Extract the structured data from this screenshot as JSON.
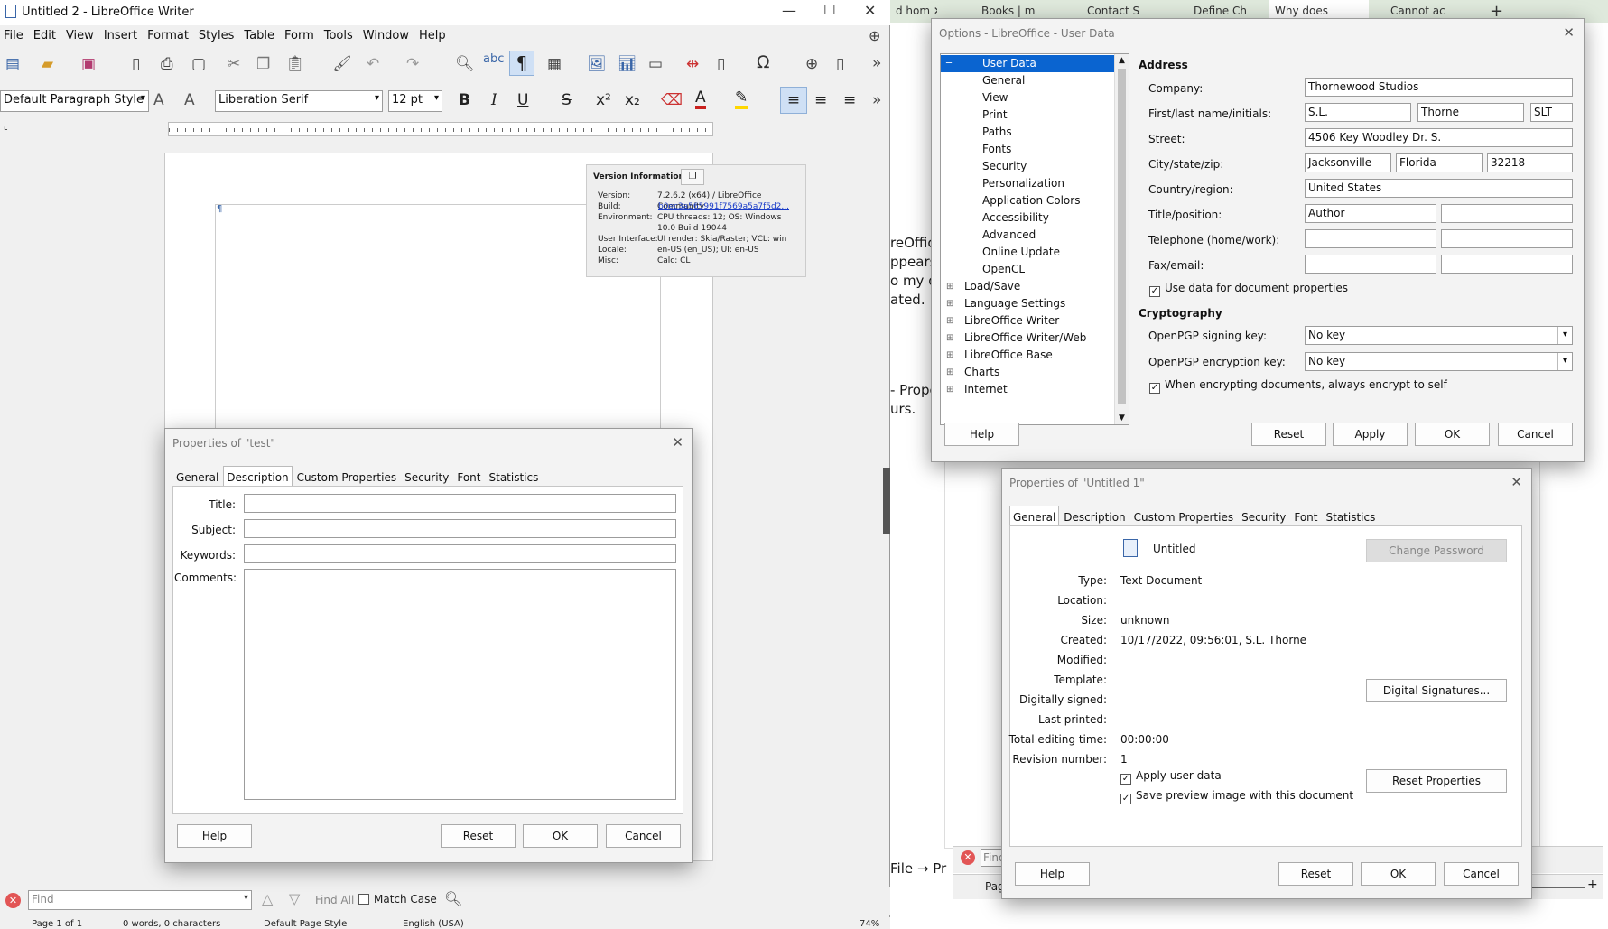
{
  "writer": {
    "title": "Untitled 2 - LibreOffice Writer",
    "menu": [
      "File",
      "Edit",
      "View",
      "Insert",
      "Format",
      "Styles",
      "Table",
      "Form",
      "Tools",
      "Window",
      "Help"
    ],
    "paragraph_style": "Default Paragraph Style",
    "font_name": "Liberation Serif",
    "font_size": "12 pt",
    "find_placeholder": "Find",
    "find_all": "Find All",
    "match_case": "Match Case",
    "status": {
      "page": "Page 1 of 1",
      "words": "0 words, 0 characters",
      "style": "Default Page Style",
      "lang": "English (USA)",
      "zoom": "74%"
    }
  },
  "version_info": {
    "title": "Version Information",
    "rows": [
      {
        "k": "Version:",
        "v": "7.2.6.2 (x64) / LibreOffice Community"
      },
      {
        "k": "Build:",
        "v": "b0ec3a565991f7569a5a7f5d2..."
      },
      {
        "k": "Environment:",
        "v": "CPU threads: 12; OS: Windows 10.0 Build 19044"
      },
      {
        "k": "User Interface:",
        "v": "UI render: Skia/Raster; VCL: win"
      },
      {
        "k": "Locale:",
        "v": "en-US (en_US); UI: en-US"
      },
      {
        "k": "Misc:",
        "v": "Calc: CL"
      }
    ]
  },
  "props_test": {
    "title": "Properties of \"test\"",
    "tabs": [
      "General",
      "Description",
      "Custom Properties",
      "Security",
      "Font",
      "Statistics"
    ],
    "active_tab": "Description",
    "labels": {
      "title": "Title:",
      "subject": "Subject:",
      "keywords": "Keywords:",
      "comments": "Comments:"
    },
    "buttons": {
      "help": "Help",
      "reset": "Reset",
      "ok": "OK",
      "cancel": "Cancel"
    }
  },
  "browser_tabs": [
    "d hom",
    "Books | m",
    "Contact S",
    "Define Ch",
    "Why does",
    "Cannot ac"
  ],
  "background_text": [
    "reOffic",
    "ppears",
    "o my do",
    "ated.",
    "- Prope",
    "urs.",
    "File → Pr"
  ],
  "options": {
    "title": "Options - LibreOffice - User Data",
    "tree": [
      {
        "label": "User Data",
        "level": 1,
        "selected": true
      },
      {
        "label": "General",
        "level": 1
      },
      {
        "label": "View",
        "level": 1
      },
      {
        "label": "Print",
        "level": 1
      },
      {
        "label": "Paths",
        "level": 1
      },
      {
        "label": "Fonts",
        "level": 1
      },
      {
        "label": "Security",
        "level": 1
      },
      {
        "label": "Personalization",
        "level": 1
      },
      {
        "label": "Application Colors",
        "level": 1
      },
      {
        "label": "Accessibility",
        "level": 1
      },
      {
        "label": "Advanced",
        "level": 1
      },
      {
        "label": "Online Update",
        "level": 1
      },
      {
        "label": "OpenCL",
        "level": 1
      },
      {
        "label": "Load/Save",
        "level": 0
      },
      {
        "label": "Language Settings",
        "level": 0
      },
      {
        "label": "LibreOffice Writer",
        "level": 0
      },
      {
        "label": "LibreOffice Writer/Web",
        "level": 0
      },
      {
        "label": "LibreOffice Base",
        "level": 0
      },
      {
        "label": "Charts",
        "level": 0
      },
      {
        "label": "Internet",
        "level": 0
      }
    ],
    "address_heading": "Address",
    "labels": {
      "company": "Company:",
      "name": "First/last name/initials:",
      "street": "Street:",
      "city": "City/state/zip:",
      "country": "Country/region:",
      "titlepos": "Title/position:",
      "phone": "Telephone (home/work):",
      "fax": "Fax/email:"
    },
    "values": {
      "company": "Thornewood Studios",
      "first": "S.L.",
      "last": "Thorne",
      "initials": "SLT",
      "street": "4506 Key Woodley Dr. S.",
      "city": "Jacksonville",
      "state": "Florida",
      "zip": "32218",
      "country": "United States",
      "titlepos": "Author"
    },
    "use_data": "Use data for document properties",
    "crypto_heading": "Cryptography",
    "sign_label": "OpenPGP signing key:",
    "enc_label": "OpenPGP encryption key:",
    "sign_value": "No key",
    "enc_value": "No key",
    "encrypt_self": "When encrypting documents, always encrypt to self",
    "buttons": {
      "help": "Help",
      "reset": "Reset",
      "apply": "Apply",
      "ok": "OK",
      "cancel": "Cancel"
    }
  },
  "props_untitled": {
    "title": "Properties of \"Untitled 1\"",
    "tabs": [
      "General",
      "Description",
      "Custom Properties",
      "Security",
      "Font",
      "Statistics"
    ],
    "active_tab": "General",
    "doc_name": "Untitled",
    "rows": [
      {
        "k": "Type:",
        "v": "Text Document"
      },
      {
        "k": "Location:",
        "v": ""
      },
      {
        "k": "Size:",
        "v": "unknown"
      },
      {
        "k": "Created:",
        "v": "10/17/2022, 09:56:01, S.L. Thorne"
      },
      {
        "k": "Modified:",
        "v": ""
      },
      {
        "k": "Template:",
        "v": ""
      },
      {
        "k": "Digitally signed:",
        "v": ""
      },
      {
        "k": "Last printed:",
        "v": ""
      },
      {
        "k": "Total editing time:",
        "v": "00:00:00"
      },
      {
        "k": "Revision number:",
        "v": "1"
      }
    ],
    "change_password": "Change Password",
    "digital_signatures": "Digital Signatures...",
    "apply_user_data": "Apply user data",
    "save_preview": "Save preview image with this document",
    "reset_properties": "Reset Properties",
    "buttons": {
      "help": "Help",
      "reset": "Reset",
      "ok": "OK",
      "cancel": "Cancel"
    },
    "find_placeholder": "Find",
    "page_fragment": "Pag"
  }
}
